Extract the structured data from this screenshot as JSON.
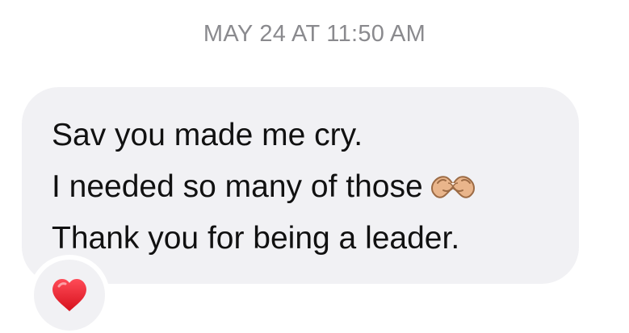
{
  "message": {
    "timestamp": "MAY 24 AT 11:50 AM",
    "lines": [
      "Sav you made me cry.",
      "I needed so many of those",
      "Thank you for being a leader."
    ],
    "inline_icon": "heart-hands-icon",
    "reaction": {
      "icon": "red-heart-icon",
      "color": "#e8212e"
    },
    "bubble_color": "#f1f1f4",
    "timestamp_color": "#8a8a8e"
  }
}
